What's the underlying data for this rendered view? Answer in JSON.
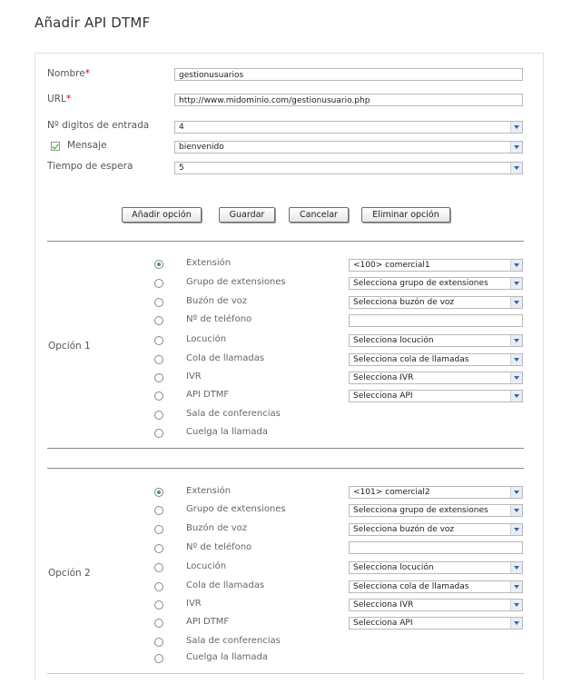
{
  "page": {
    "title": "Añadir API DTMF"
  },
  "form": {
    "nombre": {
      "label": "Nombre",
      "required_mark": "*",
      "value": "gestionusuarios"
    },
    "url": {
      "label": "URL",
      "required_mark": "*",
      "value": "http://www.midominio.com/gestionusuario.php"
    },
    "digitos": {
      "label": "Nº digitos de entrada",
      "value": "4"
    },
    "mensaje": {
      "label": "Mensaje",
      "checked": true,
      "value": "bienvenido"
    },
    "tiempo": {
      "label": "Tiempo de espera",
      "value": "5"
    }
  },
  "buttons": {
    "add_option": "Añadir opción",
    "save": "Guardar",
    "cancel": "Cancelar",
    "delete_option": "Eliminar opción"
  },
  "options": [
    {
      "label": "Opción 1",
      "items": [
        {
          "label": "Extensión",
          "selected": true,
          "select": "<100> comercial1"
        },
        {
          "label": "Grupo de extensiones",
          "selected": false,
          "select": "Selecciona grupo de extensiones"
        },
        {
          "label": "Buzón de voz",
          "selected": false,
          "select": "Selecciona buzón de voz"
        },
        {
          "label": "Nº de teléfono",
          "selected": false,
          "input": ""
        },
        {
          "label": "Locución",
          "selected": false,
          "select": "Selecciona locución"
        },
        {
          "label": "Cola de llamadas",
          "selected": false,
          "select": "Selecciona cola de llamadas"
        },
        {
          "label": "IVR",
          "selected": false,
          "select": "Selecciona IVR"
        },
        {
          "label": "API DTMF",
          "selected": false,
          "select": "Selecciona API"
        },
        {
          "label": "Sala de conferencias",
          "selected": false
        },
        {
          "label": "Cuelga la llamada",
          "selected": false
        }
      ]
    },
    {
      "label": "Opción 2",
      "items": [
        {
          "label": "Extensión",
          "selected": true,
          "select": "<101> comercial2"
        },
        {
          "label": "Grupo de extensiones",
          "selected": false,
          "select": "Selecciona grupo de extensiones"
        },
        {
          "label": "Buzón de voz",
          "selected": false,
          "select": "Selecciona buzón de voz"
        },
        {
          "label": "Nº de teléfono",
          "selected": false,
          "input": ""
        },
        {
          "label": "Locución",
          "selected": false,
          "select": "Selecciona locución"
        },
        {
          "label": "Cola de llamadas",
          "selected": false,
          "select": "Selecciona cola de llamadas"
        },
        {
          "label": "IVR",
          "selected": false,
          "select": "Selecciona IVR"
        },
        {
          "label": "API DTMF",
          "selected": false,
          "select": "Selecciona API"
        },
        {
          "label": "Sala de conferencias",
          "selected": false
        },
        {
          "label": "Cuelga la llamada",
          "selected": false
        }
      ]
    }
  ]
}
